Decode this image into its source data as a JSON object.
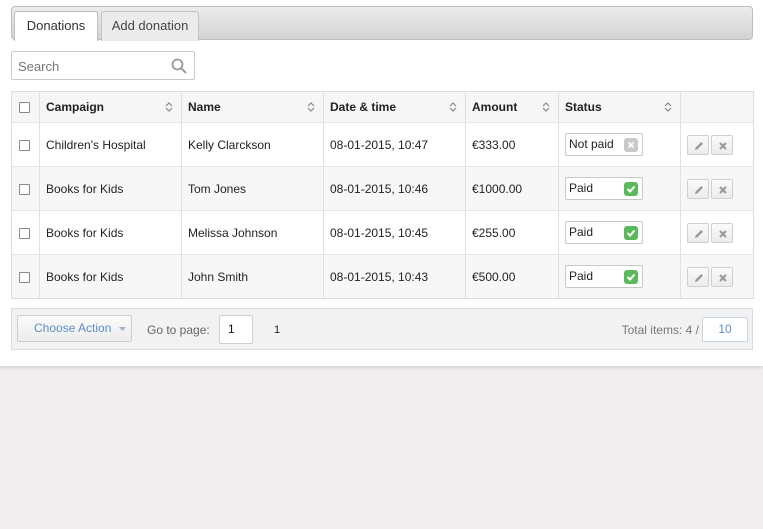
{
  "tabs": [
    {
      "label": "Donations",
      "active": true
    },
    {
      "label": "Add donation",
      "active": false
    }
  ],
  "search": {
    "placeholder": "Search",
    "icon": "search-icon"
  },
  "table": {
    "columns": [
      "Campaign",
      "Name",
      "Date & time",
      "Amount",
      "Status"
    ],
    "rows": [
      {
        "campaign": "Children's Hospital",
        "name": "Kelly Clarckson",
        "datetime": "08-01-2015, 10:47",
        "amount": "€333.00",
        "status": "Not paid"
      },
      {
        "campaign": "Books for Kids",
        "name": "Tom Jones",
        "datetime": "08-01-2015, 10:46",
        "amount": "€1000.00",
        "status": "Paid"
      },
      {
        "campaign": "Books for Kids",
        "name": "Melissa Johnson",
        "datetime": "08-01-2015, 10:45",
        "amount": "€255.00",
        "status": "Paid"
      },
      {
        "campaign": "Books for Kids",
        "name": "John Smith",
        "datetime": "08-01-2015, 10:43",
        "amount": "€500.00",
        "status": "Paid"
      }
    ]
  },
  "footer": {
    "choose_action": "Choose Action",
    "goto_label": "Go to page:",
    "page_value": "1",
    "page_link": "1",
    "total_label": "Total items: 4 /",
    "per_page": "10"
  },
  "colors": {
    "paid": "#5cb85c",
    "not_paid": "#c9c9c9",
    "link": "#5b8fc4"
  }
}
